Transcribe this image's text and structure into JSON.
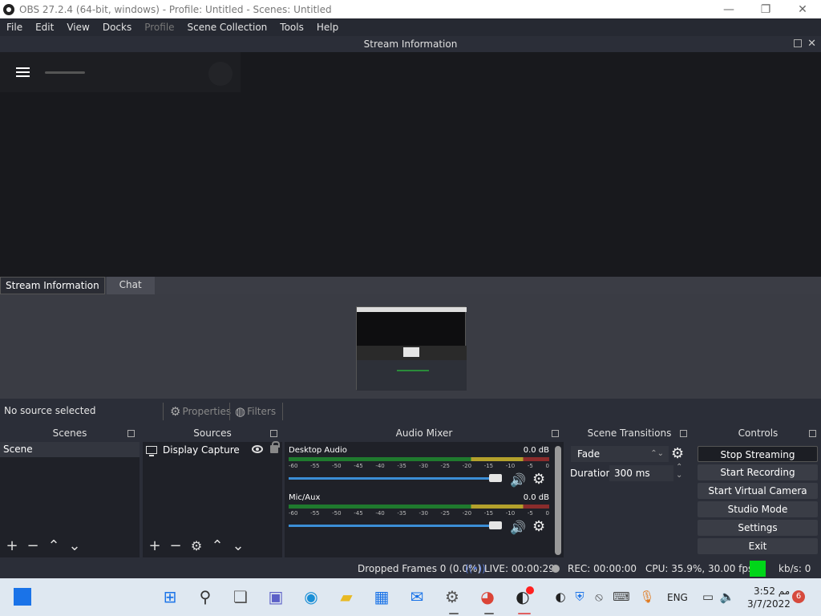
{
  "window": {
    "title": "OBS 27.2.4 (64-bit, windows) - Profile: Untitled - Scenes: Untitled",
    "minimize": "—",
    "restore": "❐",
    "close": "✕"
  },
  "menu": [
    "File",
    "Edit",
    "View",
    "Docks",
    "Profile",
    "Scene Collection",
    "Tools",
    "Help"
  ],
  "dock": {
    "title": "Stream Information",
    "close": "✕"
  },
  "tabs": {
    "stream_info": "Stream Information",
    "chat": "Chat"
  },
  "source_toolbar": {
    "no_source": "No source selected",
    "properties": "Properties",
    "filters": "Filters"
  },
  "panels": {
    "scenes": "Scenes",
    "sources": "Sources",
    "audio_mixer": "Audio Mixer",
    "scene_transitions": "Scene Transitions",
    "controls": "Controls"
  },
  "scenes": {
    "items": [
      "Scene"
    ]
  },
  "sources": {
    "items": [
      "Display Capture"
    ]
  },
  "audio_mixer": {
    "channels": [
      {
        "name": "Desktop Audio",
        "db": "0.0 dB",
        "volume": 1.0
      },
      {
        "name": "Mic/Aux",
        "db": "0.0 dB",
        "volume": 1.0
      }
    ],
    "ticks": [
      "-60",
      "-55",
      "-50",
      "-45",
      "-40",
      "-35",
      "-30",
      "-25",
      "-20",
      "-15",
      "-10",
      "-5",
      "0"
    ]
  },
  "scene_transitions": {
    "transition": "Fade",
    "duration_label": "Duration",
    "duration_value": "300 ms"
  },
  "controls": {
    "buttons": [
      "Stop Streaming",
      "Start Recording",
      "Start Virtual Camera",
      "Studio Mode",
      "Settings",
      "Exit"
    ]
  },
  "status": {
    "dropped_frames": "Dropped Frames 0 (0.0%)",
    "live": "LIVE: 00:00:29",
    "rec": "REC: 00:00:00",
    "cpu": "CPU: 35.9%, 30.00 fps",
    "kbs": "kb/s: 0",
    "indicator_color": "#00d619"
  },
  "taskbar": {
    "language": "ENG",
    "time": "3:52 مم",
    "date": "3/7/2022",
    "notifications": "6"
  },
  "colors": {
    "accent_blue": "#3b8ed6",
    "meter_green": "#1f7a2e",
    "meter_yellow": "#b3a12c",
    "meter_red": "#8a2c2c"
  }
}
